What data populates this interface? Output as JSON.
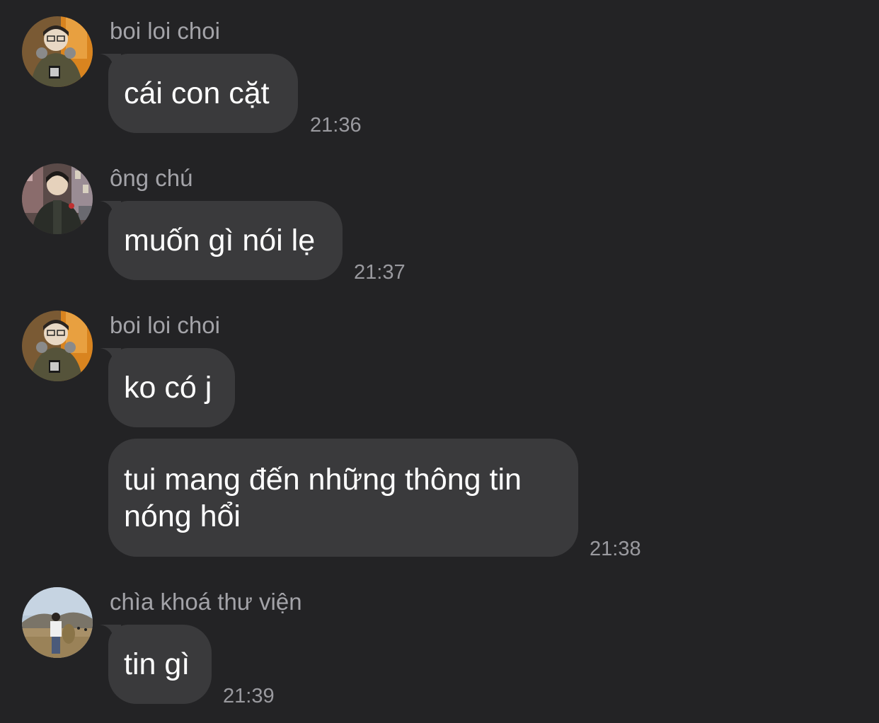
{
  "messages": [
    {
      "sender": "boi loi choi",
      "avatar": "avatar-girl-glasses",
      "texts": [
        "cái con cặt"
      ],
      "time": "21:36"
    },
    {
      "sender": "ông chú",
      "avatar": "avatar-boy-city",
      "texts": [
        "muốn gì nói lẹ"
      ],
      "time": "21:37"
    },
    {
      "sender": "boi loi choi",
      "avatar": "avatar-girl-glasses",
      "texts": [
        "ko có j",
        "tui mang đến những thông tin nóng hổi"
      ],
      "time": "21:38"
    },
    {
      "sender": "chìa khoá thư viện",
      "avatar": "avatar-field-landscape",
      "texts": [
        "tin gì"
      ],
      "time": "21:39"
    }
  ],
  "colors": {
    "background": "#232325",
    "bubble": "#3a3a3c",
    "sender_text": "#a3a3a8",
    "time_text": "#9a9a9f",
    "message_text": "#ffffff"
  }
}
